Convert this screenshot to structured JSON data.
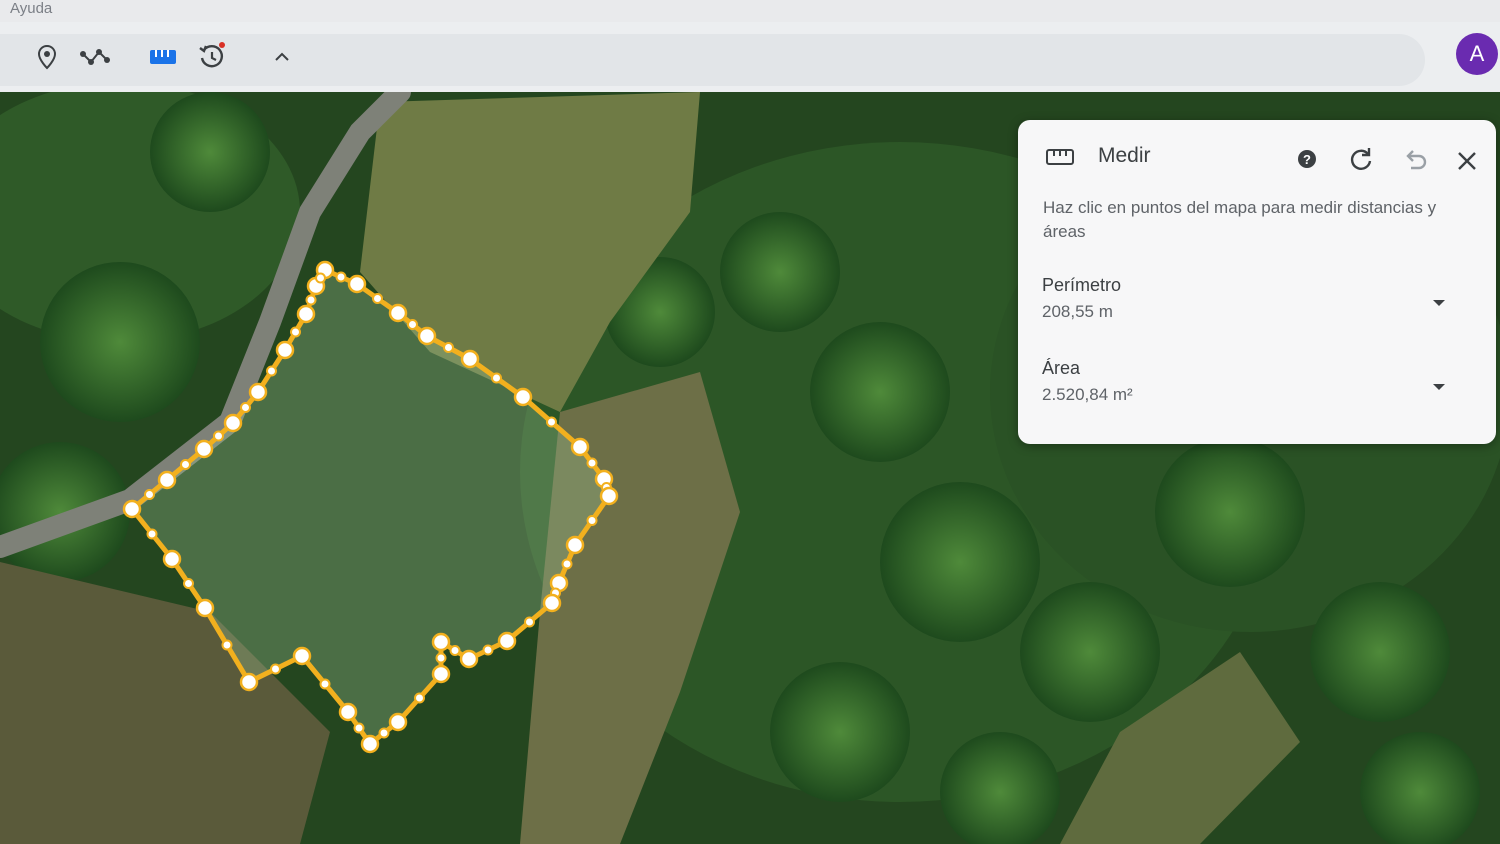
{
  "menubar": {
    "help_label": "Ayuda"
  },
  "toolbar": {
    "buttons": [
      {
        "icon": "location-pin-icon"
      },
      {
        "icon": "path-icon"
      },
      {
        "icon": "ruler-icon"
      },
      {
        "icon": "history-icon"
      },
      {
        "icon": "chevron-up-icon"
      }
    ],
    "avatar_letter": "A"
  },
  "measure_panel": {
    "title": "Medir",
    "description": "Haz clic en puntos del mapa para medir distancias y áreas",
    "perimeter_label": "Perímetro",
    "perimeter_value": "208,55 m",
    "area_label": "Área",
    "area_value": "2.520,84 m²"
  },
  "colors": {
    "measure_line": "#f2b01e",
    "avatar": "#6a2bb0"
  }
}
